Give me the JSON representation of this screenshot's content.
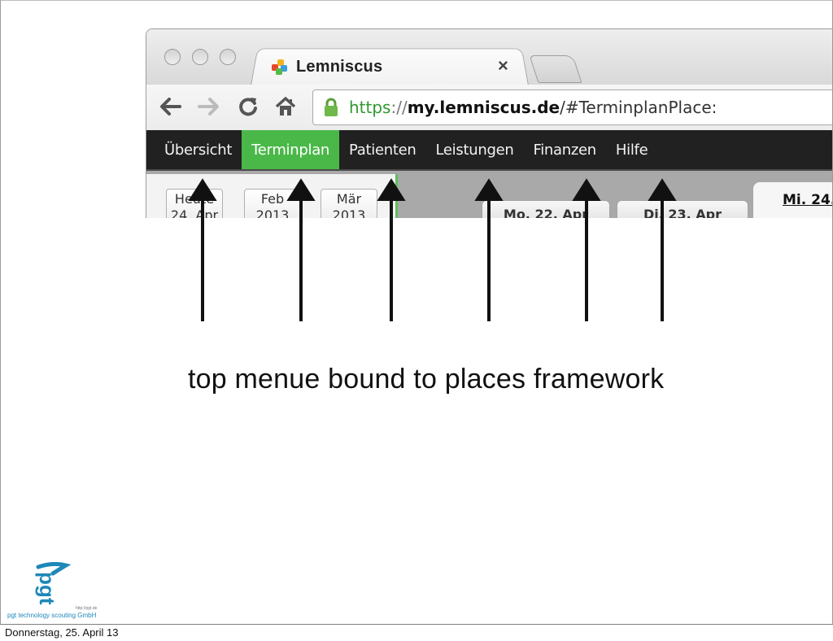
{
  "browser": {
    "tab_title": "Lemniscus",
    "tab_close": "×",
    "url": {
      "scheme": "https",
      "separator": "://",
      "host": "my.lemniscus.de",
      "path": "/#TerminplanPlace:"
    },
    "nav_icons": [
      "back-arrow-icon",
      "forward-arrow-icon",
      "reload-icon",
      "home-icon",
      "lock-icon"
    ]
  },
  "app": {
    "menu": [
      {
        "label": "Übersicht",
        "active": false
      },
      {
        "label": "Terminplan",
        "active": true
      },
      {
        "label": "Patienten",
        "active": false
      },
      {
        "label": "Leistungen",
        "active": false
      },
      {
        "label": "Finanzen",
        "active": false
      },
      {
        "label": "Hilfe",
        "active": false
      }
    ],
    "colors": {
      "menu_bg": "#212121",
      "menu_active": "#4ab848",
      "url_scheme": "#2e9a2e"
    },
    "date_nav": [
      {
        "line1": "Heute",
        "line2": "24. Apr"
      },
      {
        "line1": "Feb",
        "line2": "2013"
      },
      {
        "line1": "Mär",
        "line2": "2013"
      }
    ],
    "day_headers": [
      "Mo. 22. Apr",
      "Di. 23. Apr"
    ],
    "current_day": "Mi. 24."
  },
  "slide": {
    "caption": "top menue bound to places framework",
    "footer_date": "Donnerstag, 25. April 13",
    "logo": {
      "mark": "pgt",
      "company": "pgt technology scouting GmbH",
      "url": "http://pgt.de"
    }
  }
}
